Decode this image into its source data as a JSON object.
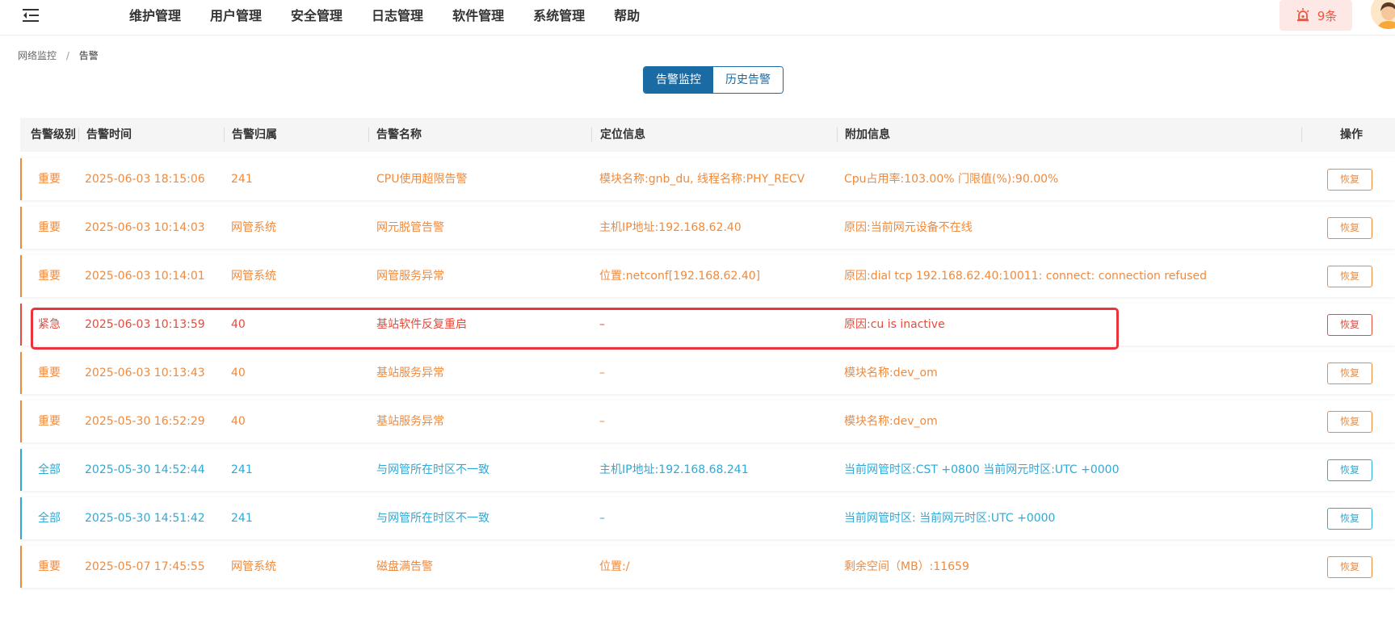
{
  "nav": {
    "items": [
      "维护管理",
      "用户管理",
      "安全管理",
      "日志管理",
      "软件管理",
      "系统管理",
      "帮助"
    ]
  },
  "alarm_badge": {
    "count_label": "9条"
  },
  "breadcrumb": {
    "parent": "网络监控",
    "separator": "/",
    "current": "告警"
  },
  "tabs": [
    {
      "label": "告警监控",
      "active": true
    },
    {
      "label": "历史告警",
      "active": false
    }
  ],
  "table": {
    "headers": [
      "告警级别",
      "告警时间",
      "告警归属",
      "告警名称",
      "定位信息",
      "附加信息",
      "操作"
    ],
    "rows": [
      {
        "level": "重要",
        "time": "2025-06-03 18:15:06",
        "owner": "241",
        "name": "CPU使用超限告警",
        "location": "模块名称:gnb_du, 线程名称:PHY_RECV",
        "extra": "Cpu占用率:103.00% 门限值(%):90.00%",
        "action": "恢复",
        "severity": "important"
      },
      {
        "level": "重要",
        "time": "2025-06-03 10:14:03",
        "owner": "网管系统",
        "name": "网元脱管告警",
        "location": "主机IP地址:192.168.62.40",
        "extra": "原因:当前网元设备不在线",
        "action": "恢复",
        "severity": "important"
      },
      {
        "level": "重要",
        "time": "2025-06-03 10:14:01",
        "owner": "网管系统",
        "name": "网管服务异常",
        "location": "位置:netconf[192.168.62.40]",
        "extra": "原因:dial tcp 192.168.62.40:10011: connect: connection refused",
        "action": "恢复",
        "severity": "important"
      },
      {
        "level": "紧急",
        "time": "2025-06-03 10:13:59",
        "owner": "40",
        "name": "基站软件反复重启",
        "location": "–",
        "extra": "原因:cu is inactive",
        "action": "恢复",
        "severity": "urgent"
      },
      {
        "level": "重要",
        "time": "2025-06-03 10:13:43",
        "owner": "40",
        "name": "基站服务异常",
        "location": "–",
        "extra": "模块名称:dev_om",
        "action": "恢复",
        "severity": "important"
      },
      {
        "level": "重要",
        "time": "2025-05-30 16:52:29",
        "owner": "40",
        "name": "基站服务异常",
        "location": "–",
        "extra": "模块名称:dev_om",
        "action": "恢复",
        "severity": "important"
      },
      {
        "level": "全部",
        "time": "2025-05-30 14:52:44",
        "owner": "241",
        "name": "与网管所在时区不一致",
        "location": "主机IP地址:192.168.68.241",
        "extra": "当前网管时区:CST +0800 当前网元时区:UTC +0000",
        "action": "恢复",
        "severity": "all"
      },
      {
        "level": "全部",
        "time": "2025-05-30 14:51:42",
        "owner": "241",
        "name": "与网管所在时区不一致",
        "location": "–",
        "extra": "当前网管时区: 当前网元时区:UTC +0000",
        "action": "恢复",
        "severity": "all"
      },
      {
        "level": "重要",
        "time": "2025-05-07 17:45:55",
        "owner": "网管系统",
        "name": "磁盘满告警",
        "location": "位置:/",
        "extra": "剩余空间（MB）:11659",
        "action": "恢复",
        "severity": "important"
      }
    ]
  },
  "colors": {
    "important": "#f08a3c",
    "urgent": "#e84a3c",
    "all": "#2fa9d6",
    "primary": "#1a6ba3",
    "highlight": "#e8343a"
  },
  "icons": {
    "menu": "menu-collapse-icon",
    "alarm": "alarm-siren-icon",
    "avatar": "user-avatar"
  }
}
